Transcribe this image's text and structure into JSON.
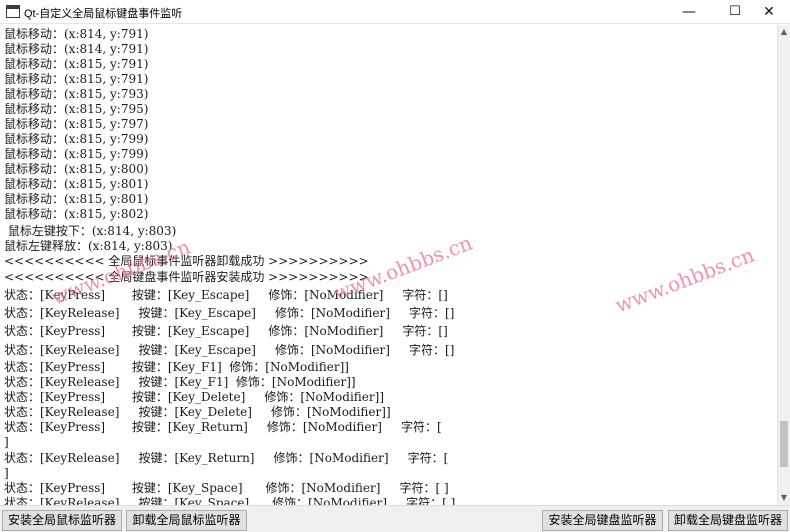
{
  "window": {
    "title": "Qt-自定义全局鼠标键盘事件监听",
    "minimize_glyph": "—",
    "maximize_glyph": "☐",
    "close_glyph": "✕",
    "icon": "window-app-icon"
  },
  "log": {
    "lines": [
      "鼠标移动：(x:814, y:791)",
      "鼠标移动：(x:814, y:791)",
      "鼠标移动：(x:815, y:791)",
      "鼠标移动：(x:815, y:791)",
      "鼠标移动：(x:815, y:793)",
      "鼠标移动：(x:815, y:795)",
      "鼠标移动：(x:815, y:797)",
      "鼠标移动：(x:815, y:799)",
      "鼠标移动：(x:815, y:799)",
      "鼠标移动：(x:815, y:800)",
      "鼠标移动：(x:815, y:801)",
      "鼠标移动：(x:815, y:801)",
      "鼠标移动：(x:815, y:802)",
      " 鼠标左键按下：(x:814, y:803)",
      "鼠标左键释放：(x:814, y:803)",
      "<<<<<<<<<< 全局鼠标事件监听器卸载成功 >>>>>>>>>>",
      "<<<<<<<<<< 全局键盘事件监听器安装成功 >>>>>>>>>>",
      "状态：[KeyPress]       按键：[Key_Escape]     修饰：[NoModifier]     字符：[]",
      "状态：[KeyRelease]     按键：[Key_Escape]     修饰：[NoModifier]     字符：[]",
      "状态：[KeyPress]       按键：[Key_Escape]     修饰：[NoModifier]     字符：[]",
      "状态：[KeyRelease]     按键：[Key_Escape]     修饰：[NoModifier]     字符：[]",
      "状态：[KeyPress]       按键：[Key_F1]  修饰：[NoModifier]]",
      "状态：[KeyRelease]     按键：[Key_F1]  修饰：[NoModifier]]",
      "状态：[KeyPress]       按键：[Key_Delete]     修饰：[NoModifier]]",
      "状态：[KeyRelease]     按键：[Key_Delete]     修饰：[NoModifier]]",
      "状态：[KeyPress]       按键：[Key_Return]     修饰：[NoModifier]     字符：[",
      "]",
      "状态：[KeyRelease]     按键：[Key_Return]     修饰：[NoModifier]     字符：[",
      "]",
      "状态：[KeyPress]       按键：[Key_Space]      修饰：[NoModifier]     字符：[ ]",
      "状态：[KeyRelease]     按键：[Key_Space]      修饰：[NoModifier]     字符：[ ]"
    ]
  },
  "watermark": {
    "text": "www.ohbbs.cn",
    "color": "#f06d8f"
  },
  "buttons": {
    "install_mouse": "安装全局鼠标监听器",
    "uninstall_mouse": "卸载全局鼠标监听器",
    "install_keyboard": "安装全局键盘监听器",
    "uninstall_keyboard": "卸载全局键盘监听器"
  },
  "scrollbar": {
    "up_glyph": "▲",
    "down_glyph": "▼"
  }
}
